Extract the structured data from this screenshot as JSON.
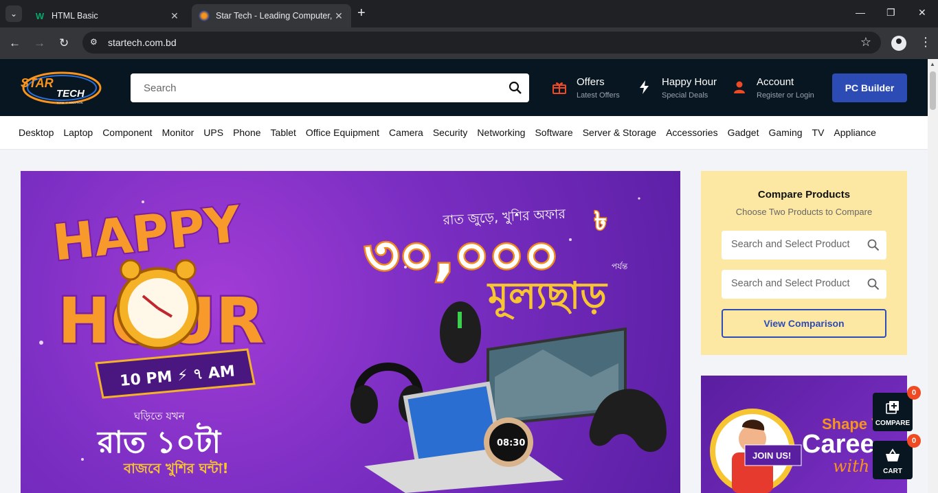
{
  "browser": {
    "tabs": [
      {
        "title": "HTML Basic",
        "active": false,
        "favicon": "w3schools-icon"
      },
      {
        "title": "Star Tech - Leading Computer, La",
        "active": true,
        "favicon": "startech-icon"
      }
    ],
    "url": "startech.com.bd"
  },
  "header": {
    "logo_text": "STAR TECH",
    "logo_tagline": "TOTAL IT SOLUTION",
    "search_placeholder": "Search",
    "offers": {
      "title": "Offers",
      "sub": "Latest Offers"
    },
    "happy_hour": {
      "title": "Happy Hour",
      "sub": "Special Deals"
    },
    "account": {
      "title": "Account",
      "sub": "Register or Login"
    },
    "pc_builder": "PC Builder"
  },
  "categories": [
    "Desktop",
    "Laptop",
    "Component",
    "Monitor",
    "UPS",
    "Phone",
    "Tablet",
    "Office Equipment",
    "Camera",
    "Security",
    "Networking",
    "Software",
    "Server & Storage",
    "Accessories",
    "Gadget",
    "Gaming",
    "TV",
    "Appliance"
  ],
  "banner": {
    "happy": "HAPPY",
    "hour": "HOUR",
    "time": "10 PM ⚡ ৭ AM",
    "bn_small": "ঘড়িতে যখন",
    "bn_big": "রাত ১০টা",
    "bn_sub": "বাজবে খুশির ঘন্টা!",
    "offer_line": "রাত জুড়ে, খুশির অফার",
    "amount": "৩০,০০০",
    "currency": "৳",
    "upto": "পর্যন্ত",
    "discount": "মূল্যছাড়",
    "watch_time": "08:30"
  },
  "compare": {
    "title": "Compare Products",
    "subtitle": "Choose Two Products to Compare",
    "input1_placeholder": "Search and Select Product",
    "input2_placeholder": "Search and Select Product",
    "button": "View Comparison"
  },
  "career": {
    "join": "JOIN US!",
    "shape": "Shape Y",
    "career": "Caree",
    "with": "with"
  },
  "floating": {
    "compare_label": "COMPARE",
    "compare_count": "0",
    "cart_label": "CART",
    "cart_count": "0"
  },
  "colors": {
    "header_bg": "#081621",
    "accent": "#ef4a23",
    "primary": "#2c4bb5",
    "compare_bg": "#fde8a3"
  }
}
